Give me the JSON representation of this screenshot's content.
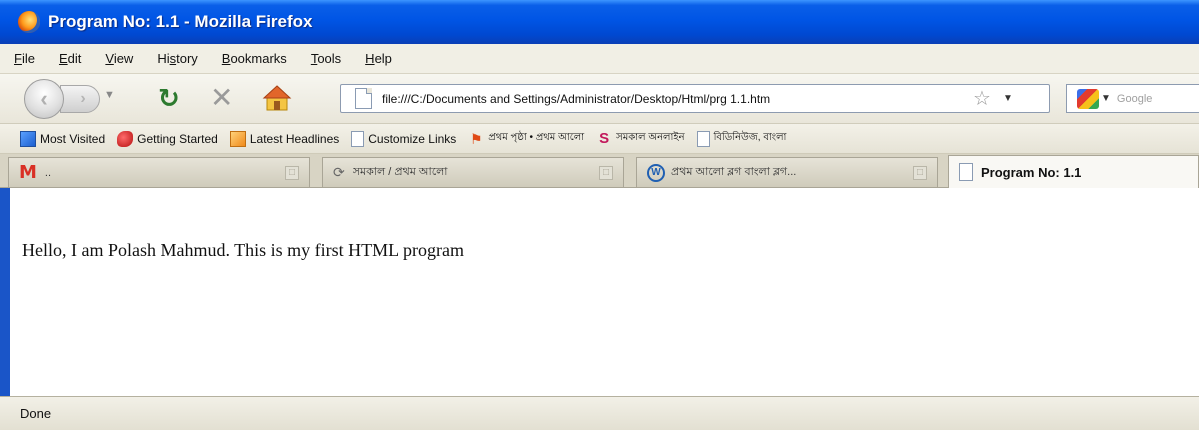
{
  "window": {
    "title": "Program No: 1.1 - Mozilla Firefox"
  },
  "menu": {
    "items": [
      {
        "label": "File",
        "accesskey": "F"
      },
      {
        "label": "Edit",
        "accesskey": "E"
      },
      {
        "label": "View",
        "accesskey": "V"
      },
      {
        "label": "History",
        "accesskey": "s"
      },
      {
        "label": "Bookmarks",
        "accesskey": "B"
      },
      {
        "label": "Tools",
        "accesskey": "T"
      },
      {
        "label": "Help",
        "accesskey": "H"
      }
    ]
  },
  "toolbar": {
    "url": "file:///C:/Documents and Settings/Administrator/Desktop/Html/prg 1.1.htm",
    "search_placeholder": "Google",
    "icons": {
      "back": "back-arrow-icon",
      "forward": "forward-arrow-icon",
      "reload": "reload-icon",
      "stop": "stop-icon",
      "home": "home-icon",
      "bookmark_star": "star-icon"
    }
  },
  "bookmarks": {
    "items": [
      {
        "label": "Most Visited",
        "icon": "most-visited-icon"
      },
      {
        "label": "Getting Started",
        "icon": "firefox-icon"
      },
      {
        "label": "Latest Headlines",
        "icon": "rss-icon"
      },
      {
        "label": "Customize Links",
        "icon": "page-icon"
      },
      {
        "label": "প্রথম পৃষ্ঠা • প্রথম আলো",
        "icon": "flag-icon"
      },
      {
        "label": "সমকাল অনলাইন",
        "icon": "s-icon"
      },
      {
        "label": "বিডিনিউজ, বাংলা",
        "icon": "page-icon"
      }
    ]
  },
  "tabs": [
    {
      "label": "M",
      "icon": "gmail-icon",
      "active": false
    },
    {
      "label": "সমকাল / প্রথম আলো",
      "icon": "loading-icon",
      "active": false
    },
    {
      "label": "প্রথম আলো ব্লগ বাংলা ব্লগ...",
      "icon": "wordpress-icon",
      "active": false
    },
    {
      "label": "Program No: 1.1",
      "icon": "page-icon",
      "active": true
    }
  ],
  "page": {
    "text": "Hello, I am Polash Mahmud. This is my first HTML program"
  },
  "status": {
    "text": "Done"
  },
  "colors": {
    "titlebar": "#0055e5",
    "chrome": "#ece9d8",
    "window_border": "#1a55c8"
  }
}
